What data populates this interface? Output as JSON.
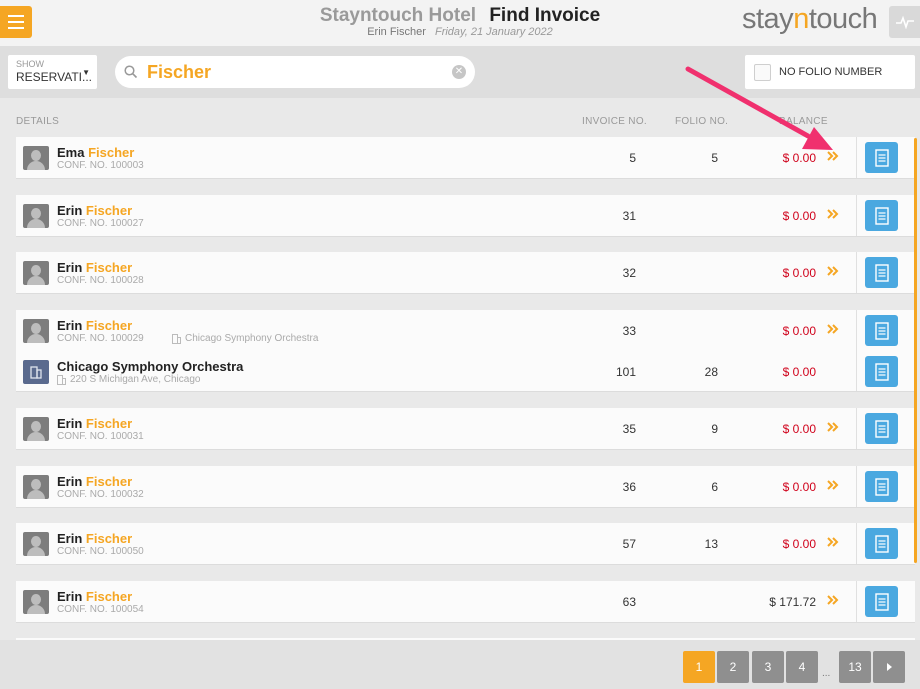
{
  "header": {
    "hotel": "Stayntouch Hotel",
    "page_title": "Find Invoice",
    "user": "Erin Fischer",
    "date": "Friday, 21 January 2022",
    "logo_left": "stay",
    "logo_mid": "n",
    "logo_right": "touch"
  },
  "filters": {
    "show_label": "SHOW",
    "show_value": "RESERVATI...",
    "search_value": "Fischer",
    "no_folio_label": "NO FOLIO NUMBER"
  },
  "columns": {
    "details": "DETAILS",
    "invoice": "INVOICE NO.",
    "folio": "FOLIO NO.",
    "balance": "BALANCE"
  },
  "rows": [
    {
      "first": "Ema",
      "last": "Fischer",
      "conf": "CONF. NO. 100003",
      "invoice": "5",
      "folio": "5",
      "balance": "$ 0.00"
    },
    {
      "first": "Erin",
      "last": "Fischer",
      "conf": "CONF. NO. 100027",
      "invoice": "31",
      "folio": "",
      "balance": "$ 0.00"
    },
    {
      "first": "Erin",
      "last": "Fischer",
      "conf": "CONF. NO. 100028",
      "invoice": "32",
      "folio": "",
      "balance": "$ 0.00"
    },
    {
      "first": "Erin",
      "last": "Fischer",
      "conf": "CONF. NO. 100029",
      "company": "Chicago Symphony Orchestra",
      "invoice": "33",
      "folio": "",
      "balance": "$ 0.00"
    },
    {
      "first": "Erin",
      "last": "Fischer",
      "conf": "CONF. NO. 100031",
      "invoice": "35",
      "folio": "9",
      "balance": "$ 0.00"
    },
    {
      "first": "Erin",
      "last": "Fischer",
      "conf": "CONF. NO. 100032",
      "invoice": "36",
      "folio": "6",
      "balance": "$ 0.00"
    },
    {
      "first": "Erin",
      "last": "Fischer",
      "conf": "CONF. NO. 100050",
      "invoice": "57",
      "folio": "13",
      "balance": "$ 0.00"
    },
    {
      "first": "Erin",
      "last": "Fischer",
      "conf": "CONF. NO. 100054",
      "invoice": "63",
      "folio": "",
      "balance": "$ 171.72"
    }
  ],
  "company_row": {
    "name": "Chicago Symphony Orchestra",
    "address": "220 S Michigan Ave, Chicago",
    "invoice": "101",
    "folio": "28",
    "balance": "$ 0.00"
  },
  "pagination": {
    "pages": [
      "1",
      "2",
      "3",
      "4",
      "13"
    ],
    "current": "1",
    "ellipsis": "..."
  },
  "colors": {
    "accent": "#f5a623",
    "invoice_button": "#4aa8e0",
    "negative_balance": "#d0021b",
    "annotation_arrow": "#f0306e"
  },
  "icons": {
    "menu": "hamburger-icon",
    "search": "search-icon",
    "clear": "clear-icon",
    "guest": "guest-avatar-icon",
    "company": "building-icon",
    "open": "double-chevron-right-icon",
    "invoice": "invoice-icon",
    "next": "caret-right-icon"
  }
}
